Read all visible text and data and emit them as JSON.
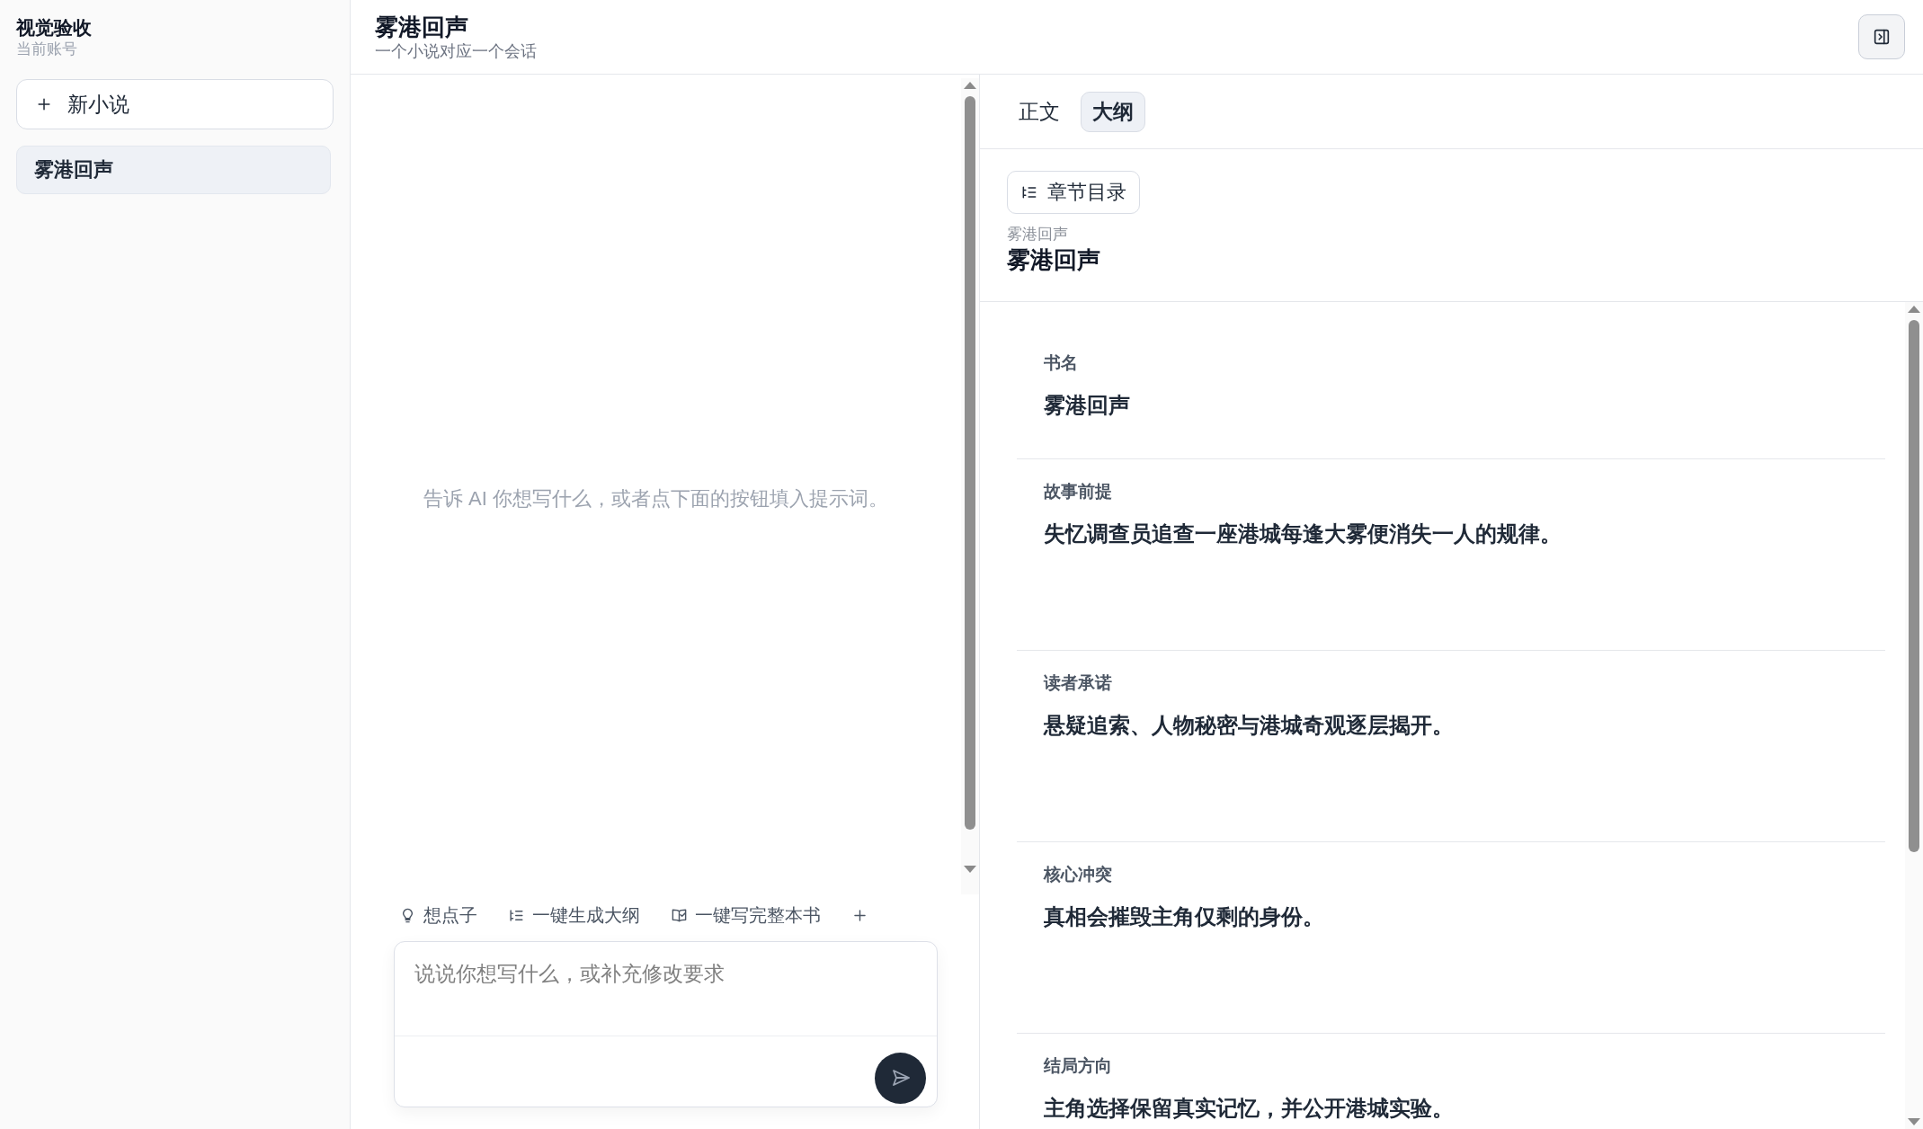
{
  "sidebar": {
    "title": "视觉验收",
    "subtitle": "当前账号",
    "new_button": "新小说",
    "items": [
      {
        "label": "雾港回声",
        "selected": true
      }
    ]
  },
  "header": {
    "title": "雾港回声",
    "subtitle": "一个小说对应一个会话"
  },
  "chat": {
    "empty_hint": "告诉 AI 你想写什么，或者点下面的按钮填入提示词。",
    "quick_actions": [
      {
        "kind": "idea",
        "label": "想点子"
      },
      {
        "kind": "outline",
        "label": "一键生成大纲"
      },
      {
        "kind": "book",
        "label": "一键写完整本书"
      },
      {
        "kind": "add"
      }
    ],
    "composer": {
      "placeholder": "说说你想写什么，或补充修改要求"
    }
  },
  "editor": {
    "tabs": [
      {
        "label": "正文",
        "selected": false
      },
      {
        "label": "大纲",
        "selected": true
      }
    ],
    "toc_button": "章节目录",
    "breadcrumb": "雾港回声",
    "title": "雾港回声",
    "sections": [
      {
        "kind": "line",
        "label": "书名",
        "value": "雾港回声"
      },
      {
        "kind": "text",
        "label": "故事前提",
        "value": "失忆调查员追查一座港城每逢大雾便消失一人的规律。"
      },
      {
        "kind": "text",
        "label": "读者承诺",
        "value": "悬疑追索、人物秘密与港城奇观逐层揭开。"
      },
      {
        "kind": "text",
        "label": "核心冲突",
        "value": "真相会摧毁主角仅剩的身份。"
      },
      {
        "kind": "text",
        "label": "结局方向",
        "value": "主角选择保留真实记忆，并公开港城实验。"
      }
    ]
  }
}
